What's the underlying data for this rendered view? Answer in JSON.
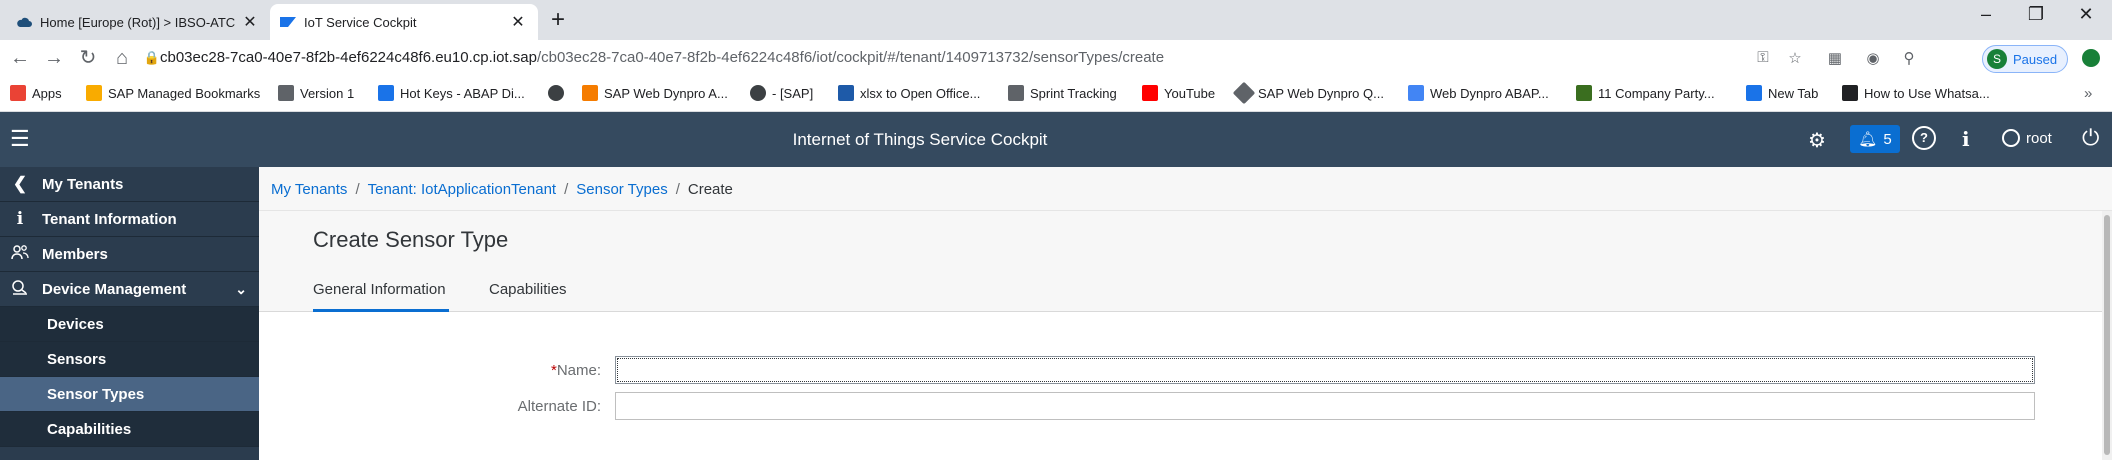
{
  "browser": {
    "tabs": [
      {
        "title": "Home [Europe (Rot)] > IBSO-ATC",
        "favicon": "cloud-icon",
        "active": false
      },
      {
        "title": "IoT Service Cockpit",
        "favicon": "sap-icon",
        "active": true
      }
    ],
    "new_tab": "+",
    "window_controls": {
      "minimize": "–",
      "restore": "❐",
      "close": "✕"
    },
    "url_host": "cb03ec28-7ca0-40e7-8f2b-4ef6224c48f6.eu10.cp.iot.sap",
    "url_path": "/cb03ec28-7ca0-40e7-8f2b-4ef6224c48f6/iot/cockpit/#/tenant/1409713732/sensorTypes/create",
    "profile_initial": "S",
    "profile_status": "Paused",
    "bookmarks": [
      "Apps",
      "SAP Managed Bookmarks",
      "Version 1",
      "Hot Keys - ABAP Di...",
      "SAP Web Dynpro A...",
      "- [SAP]",
      "xlsx to Open Office...",
      "Sprint Tracking",
      "YouTube",
      "SAP Web Dynpro Q...",
      "Web Dynpro ABAP...",
      "11 Company Party...",
      "New Tab",
      "How to Use Whatsa..."
    ],
    "bookmarks_more": "»"
  },
  "shell": {
    "title": "Internet of Things Service Cockpit",
    "notification_count": "5",
    "user": "root"
  },
  "sidebar": {
    "items": [
      {
        "label": "My Tenants",
        "icon": "chevron-left-icon",
        "glyph": "❮"
      },
      {
        "label": "Tenant Information",
        "icon": "info-icon",
        "glyph": "i"
      },
      {
        "label": "Members",
        "icon": "members-icon",
        "glyph": "👥"
      },
      {
        "label": "Device Management",
        "icon": "device-management-icon",
        "glyph": "⚙"
      },
      {
        "label": "Devices"
      },
      {
        "label": "Sensors"
      },
      {
        "label": "Sensor Types"
      },
      {
        "label": "Capabilities"
      }
    ]
  },
  "breadcrumb": {
    "items": [
      "My Tenants",
      "Tenant: IotApplicationTenant",
      "Sensor Types"
    ],
    "separator": "/",
    "current": "Create"
  },
  "page": {
    "title": "Create Sensor Type",
    "tabs": [
      "General Information",
      "Capabilities"
    ],
    "selected_tab": "General Information"
  },
  "form": {
    "name_required_mark": "*",
    "name_label": "Name:",
    "name_value": "",
    "alternate_id_label": "Alternate ID:",
    "alternate_id_value": ""
  },
  "colors": {
    "shell": "#354a5f",
    "sidebar": "#2b3c4e",
    "sidebar_selected": "#4a6585",
    "accent": "#0a6ed1",
    "required": "#bb0000"
  }
}
